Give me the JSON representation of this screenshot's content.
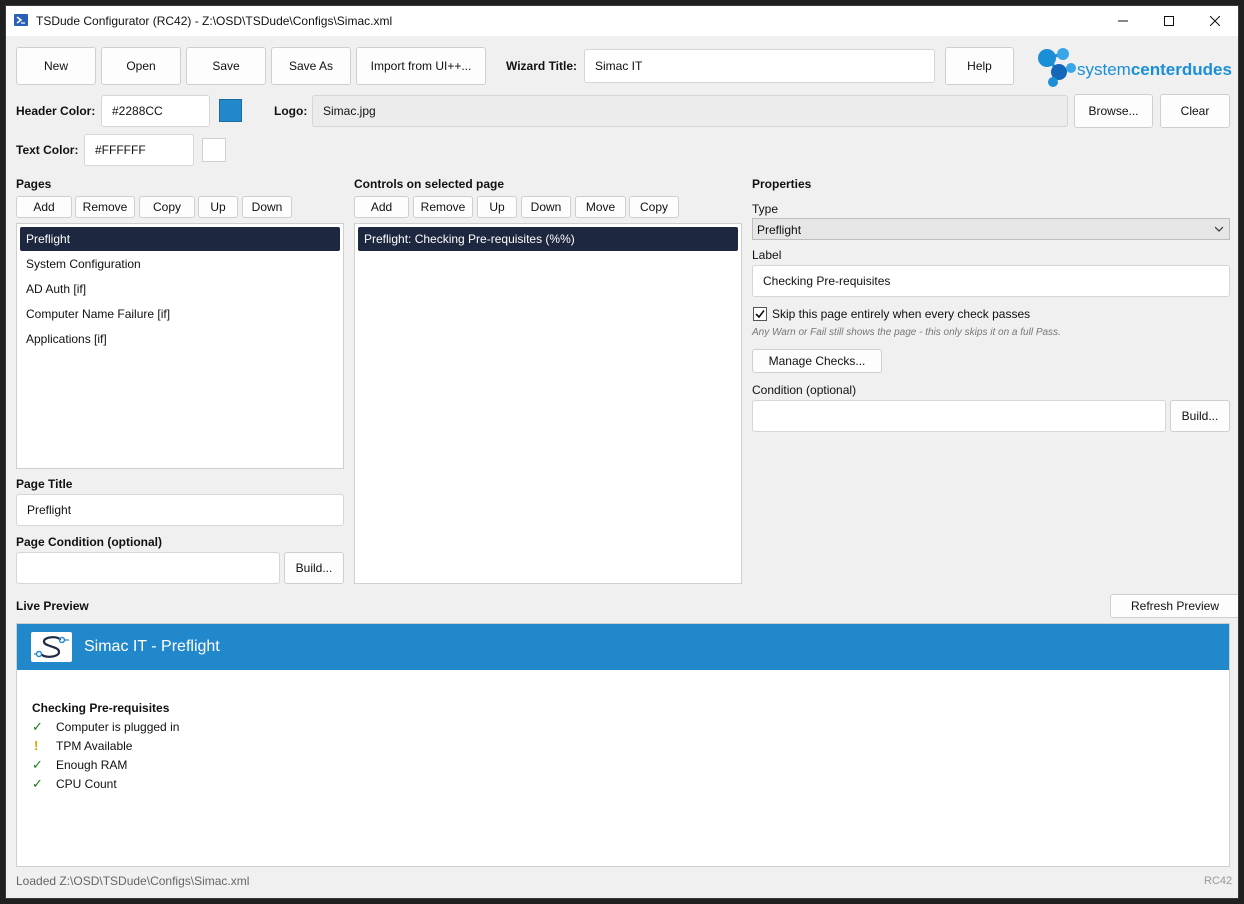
{
  "window": {
    "title": "TSDude Configurator (RC42) - Z:\\OSD\\TSDude\\Configs\\Simac.xml"
  },
  "toolbar": {
    "new": "New",
    "open": "Open",
    "save": "Save",
    "save_as": "Save As",
    "import": "Import from UI++...",
    "wizard_title_label": "Wizard Title:",
    "wizard_title_value": "Simac IT",
    "help": "Help"
  },
  "brand": {
    "logo_text_light": "system",
    "logo_text_bold": "centerdudes"
  },
  "header_color": {
    "label": "Header Color:",
    "value": "#2288CC"
  },
  "logo": {
    "label": "Logo:",
    "value": "Simac.jpg",
    "browse": "Browse...",
    "clear": "Clear"
  },
  "text_color": {
    "label": "Text Color:",
    "value": "#FFFFFF"
  },
  "pages": {
    "heading": "Pages",
    "buttons": {
      "add": "Add",
      "remove": "Remove",
      "copy": "Copy",
      "up": "Up",
      "down": "Down"
    },
    "items": [
      "Preflight",
      "System Configuration",
      "AD Auth [if]",
      "Computer Name Failure [if]",
      "Applications [if]"
    ],
    "selected_index": 0,
    "page_title_label": "Page Title",
    "page_title_value": "Preflight",
    "page_condition_label": "Page Condition (optional)",
    "page_condition_value": "",
    "build": "Build..."
  },
  "controls": {
    "heading": "Controls on selected page",
    "buttons": {
      "add": "Add",
      "remove": "Remove",
      "up": "Up",
      "down": "Down",
      "move": "Move",
      "copy": "Copy"
    },
    "items": [
      "Preflight: Checking Pre-requisites (%%)"
    ]
  },
  "properties": {
    "heading": "Properties",
    "type_label": "Type",
    "type_value": "Preflight",
    "label_label": "Label",
    "label_value": "Checking Pre-requisites",
    "skip_label": "Skip this page entirely when every check passes",
    "skip_checked": true,
    "skip_note": "Any Warn or Fail still shows the page - this only skips it on a full Pass.",
    "manage_checks": "Manage Checks...",
    "condition_label": "Condition (optional)",
    "condition_value": "",
    "build": "Build..."
  },
  "preview": {
    "heading": "Live Preview",
    "refresh": "Refresh Preview",
    "title": "Simac IT - Preflight",
    "header_color": "#2288CC",
    "section_title": "Checking Pre-requisites",
    "checks": [
      {
        "mark": "✓",
        "status": "pass",
        "label": "Computer is plugged in"
      },
      {
        "mark": "!",
        "status": "warn",
        "label": "TPM Available"
      },
      {
        "mark": "✓",
        "status": "pass",
        "label": "Enough RAM"
      },
      {
        "mark": "✓",
        "status": "pass",
        "label": "CPU Count"
      }
    ]
  },
  "status": {
    "message": "Loaded Z:\\OSD\\TSDude\\Configs\\Simac.xml",
    "version": "RC42"
  },
  "colors": {
    "pass": "#1a7a1a",
    "warn": "#d9a400",
    "selection": "#1e2740"
  }
}
